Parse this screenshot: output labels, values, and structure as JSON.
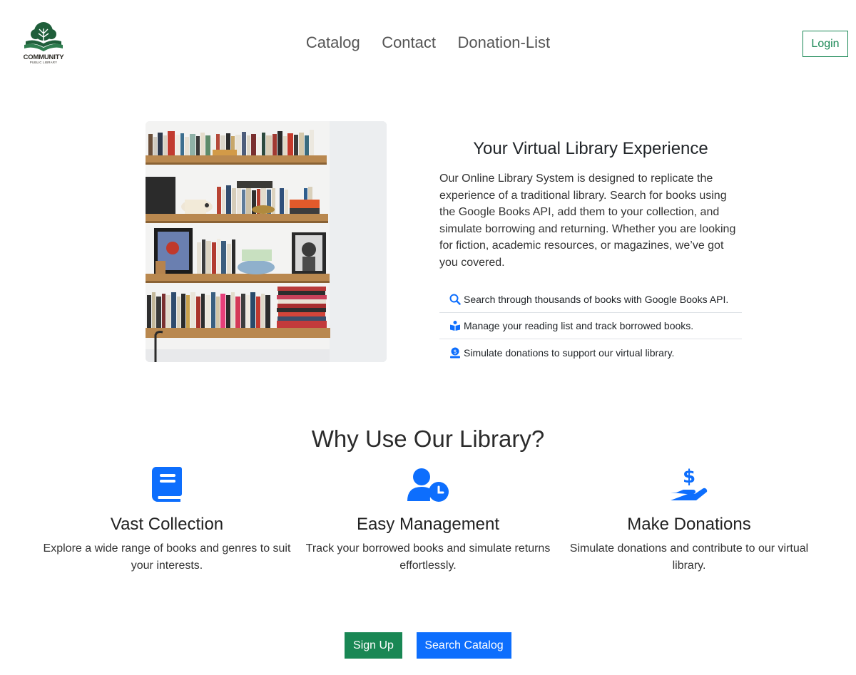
{
  "header": {
    "logo_title": "COMMUNITY",
    "logo_subtitle": "PUBLIC LIBRARY",
    "nav": [
      "Catalog",
      "Contact",
      "Donation-List"
    ],
    "login_label": "Login"
  },
  "hero": {
    "image_alt": "bookshelf",
    "title": "Your Virtual Library Experience",
    "description": "Our Online Library System is designed to replicate the experience of a traditional library. Search for books using the Google Books API, add them to your collection, and simulate borrowing and returning. Whether you are looking for fiction, academic resources, or magazines, we’ve got you covered.",
    "features": [
      {
        "icon": "search-icon",
        "text": "Search through thousands of books with Google Books API."
      },
      {
        "icon": "reader-icon",
        "text": "Manage your reading list and track borrowed books."
      },
      {
        "icon": "donate-icon",
        "text": "Simulate donations to support our virtual library."
      }
    ]
  },
  "why": {
    "title": "Why Use Our Library?",
    "columns": [
      {
        "icon": "book-icon",
        "title": "Vast Collection",
        "text": "Explore a wide range of books and genres to suit your interests."
      },
      {
        "icon": "user-clock-icon",
        "title": "Easy Management",
        "text": "Track your borrowed books and simulate returns effortlessly."
      },
      {
        "icon": "hand-dollar-icon",
        "title": "Make Donations",
        "text": "Simulate donations and contribute to our virtual library."
      }
    ]
  },
  "actions": {
    "signup_label": "Sign Up",
    "search_label": "Search Catalog"
  },
  "colors": {
    "primary": "#0d6efd",
    "success": "#198754",
    "logo_green": "#1f5e3a"
  }
}
